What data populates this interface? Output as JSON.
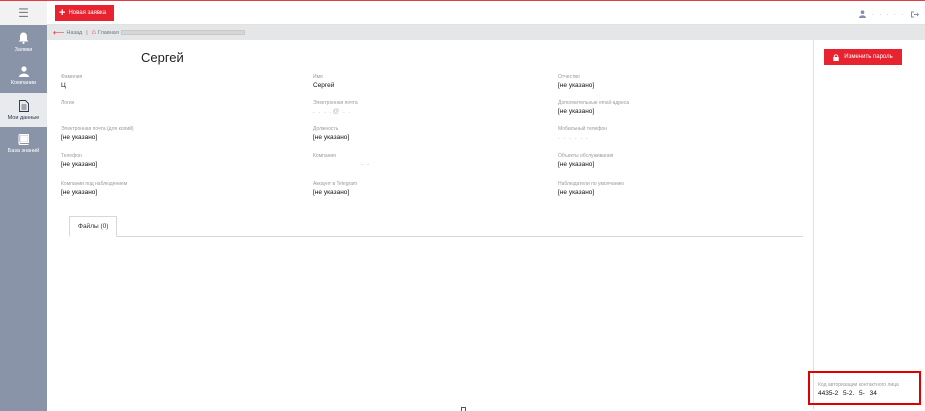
{
  "topbar": {
    "new_request_label": "Новая заявка",
    "user_name": ". . . . ."
  },
  "sidebar": {
    "items": [
      {
        "label": "Заявки",
        "icon": "bell-icon",
        "active": false
      },
      {
        "label": "Компании",
        "icon": "user-icon",
        "active": false
      },
      {
        "label": "Мои данные",
        "icon": "document-icon",
        "active": true
      },
      {
        "label": "База знаний",
        "icon": "book-icon",
        "active": false
      }
    ]
  },
  "breadcrumb": {
    "back_label": "Назад",
    "home_label": "Главная"
  },
  "profile": {
    "name": "Сергей",
    "fields": {
      "last_name": {
        "label": "Фамилия",
        "value": "Ц"
      },
      "first_name": {
        "label": "Имя",
        "value": "Сергей"
      },
      "middle_name": {
        "label": "Отчество",
        "value": "[не указано]"
      },
      "login": {
        "label": "Логин",
        "value": ""
      },
      "email": {
        "label": "Электронная почта",
        "value": ". . . .@ . ."
      },
      "extra_email": {
        "label": "Дополнительные email-адреса",
        "value": "[не указано]"
      },
      "copy_email": {
        "label": "Электронная почта (для копий)",
        "value": "[не указано]"
      },
      "position": {
        "label": "Должность",
        "value": "[не указано]"
      },
      "mobile": {
        "label": "Мобильный телефон",
        "value": ". . . . . ."
      },
      "phone": {
        "label": "Телефон",
        "value": "[не указано]"
      },
      "company": {
        "label": "Компания",
        "value": "- -"
      },
      "service_objects": {
        "label": "Объекты обслуживания",
        "value": "[не указано]"
      },
      "watched_companies": {
        "label": "Компании под наблюдением",
        "value": "[не указано]"
      },
      "telegram": {
        "label": "Аккаунт в Telegram",
        "value": "[не указано]"
      },
      "default_watchers": {
        "label": "Наблюдатели по умолчанию",
        "value": "[не указано]"
      }
    }
  },
  "tabs": {
    "files_label": "Файлы (0)"
  },
  "rightpanel": {
    "change_password_label": "Изменить пароль",
    "auth_code_label": "Код авторизации контактного лица",
    "auth_code_value": "4435-2 5-2. 5- 34"
  },
  "colors": {
    "accent": "#e8232f",
    "sidebar": "#8a94a8",
    "highlight_box": "#e00000"
  }
}
